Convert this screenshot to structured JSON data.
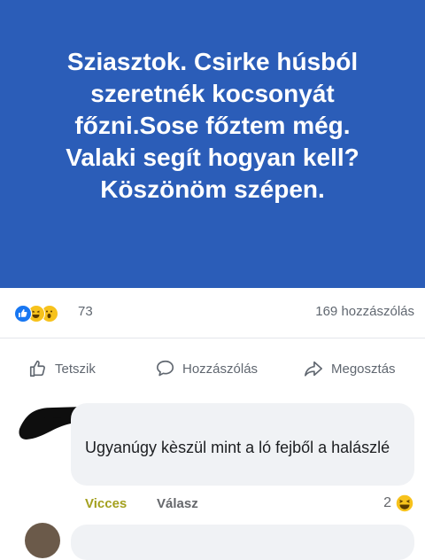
{
  "post": {
    "text": "Sziasztok. Csirke húsból\nszeretnék kocsonyát\nfőzni.Sose főztem még.\nValaki segít hogyan kell?\nKöszönöm szépen.",
    "background_color": "#2b5db8"
  },
  "reactions": {
    "icons": [
      "like-icon",
      "haha-icon",
      "wow-icon"
    ],
    "count": "73",
    "comments_label": "169 hozzászólás"
  },
  "actions": {
    "like": "Tetszik",
    "comment": "Hozzászólás",
    "share": "Megosztás"
  },
  "comment": {
    "text": "Ugyanúgy kèszül mint a ló fejből a halászlé",
    "time": "Vicces",
    "reply": "Válasz",
    "reaction_count": "2",
    "reaction_icon": "haha-icon"
  },
  "colors": {
    "accent": "#1877f2",
    "comment_bg": "#f0f2f5",
    "meta_text": "#606770"
  }
}
